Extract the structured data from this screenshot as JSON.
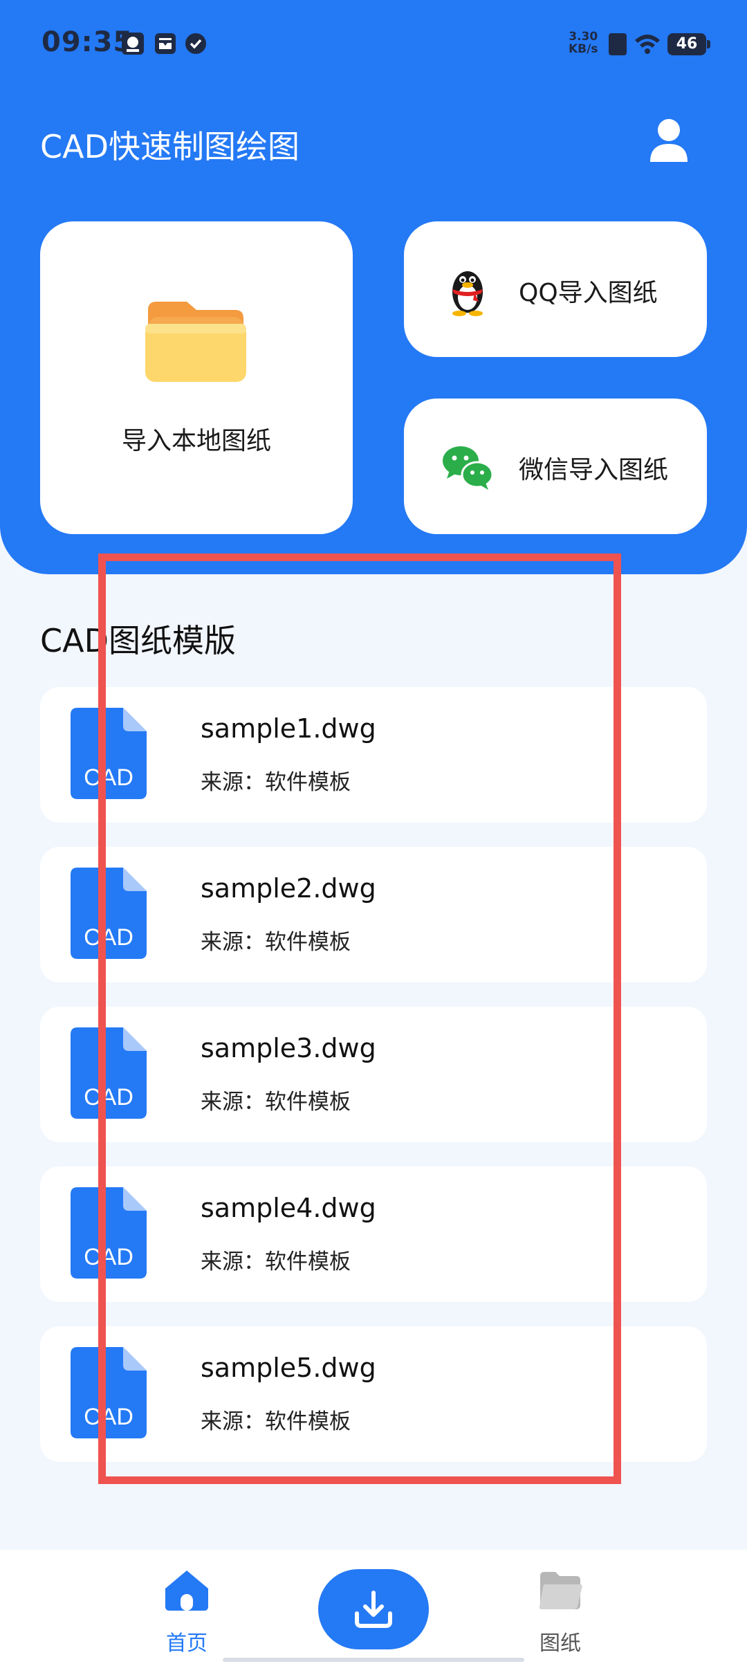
{
  "status_bar": {
    "time": "09:35",
    "net_speed_value": "3.30",
    "net_speed_unit": "KB/s",
    "battery": "46"
  },
  "header": {
    "app_title": "CAD快速制图绘图",
    "user_icon": "user-icon"
  },
  "import": {
    "local_label": "导入本地图纸",
    "qq_label": "QQ导入图纸",
    "wechat_label": "微信导入图纸"
  },
  "templates": {
    "title": "CAD图纸模版",
    "file_icon_text": "CAD",
    "items": [
      {
        "name": "sample1.dwg",
        "source": "来源：软件模板"
      },
      {
        "name": "sample2.dwg",
        "source": "来源：软件模板"
      },
      {
        "name": "sample3.dwg",
        "source": "来源：软件模板"
      },
      {
        "name": "sample4.dwg",
        "source": "来源：软件模板"
      },
      {
        "name": "sample5.dwg",
        "source": "来源：软件模板"
      }
    ]
  },
  "bottom_nav": {
    "home_label": "首页",
    "drawings_label": "图纸"
  },
  "colors": {
    "primary": "#2479f5",
    "highlight": "#ef5350",
    "background": "#f2f6fd"
  }
}
